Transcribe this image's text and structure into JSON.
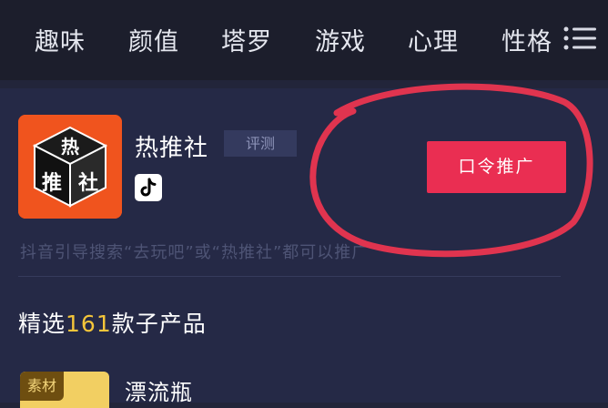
{
  "tabs": [
    "趣味",
    "颜值",
    "塔罗",
    "游戏",
    "心理",
    "性格"
  ],
  "app": {
    "name": "热推社",
    "badge": "评测",
    "icon_chars": [
      "热",
      "推",
      "社"
    ],
    "platform_icon": "tiktok-icon"
  },
  "promo_button": "口令推广",
  "hint": "抖音引导搜索“去玩吧”或“热推社”都可以推广",
  "section": {
    "prefix": "精选",
    "count": "161",
    "suffix": "款子产品"
  },
  "product": {
    "tag": "素材",
    "name": "漂流瓶"
  },
  "colors": {
    "background": "#22253a",
    "accent": "#ea2e52",
    "highlight": "#f4c53a",
    "annotation": "#e0344f"
  }
}
